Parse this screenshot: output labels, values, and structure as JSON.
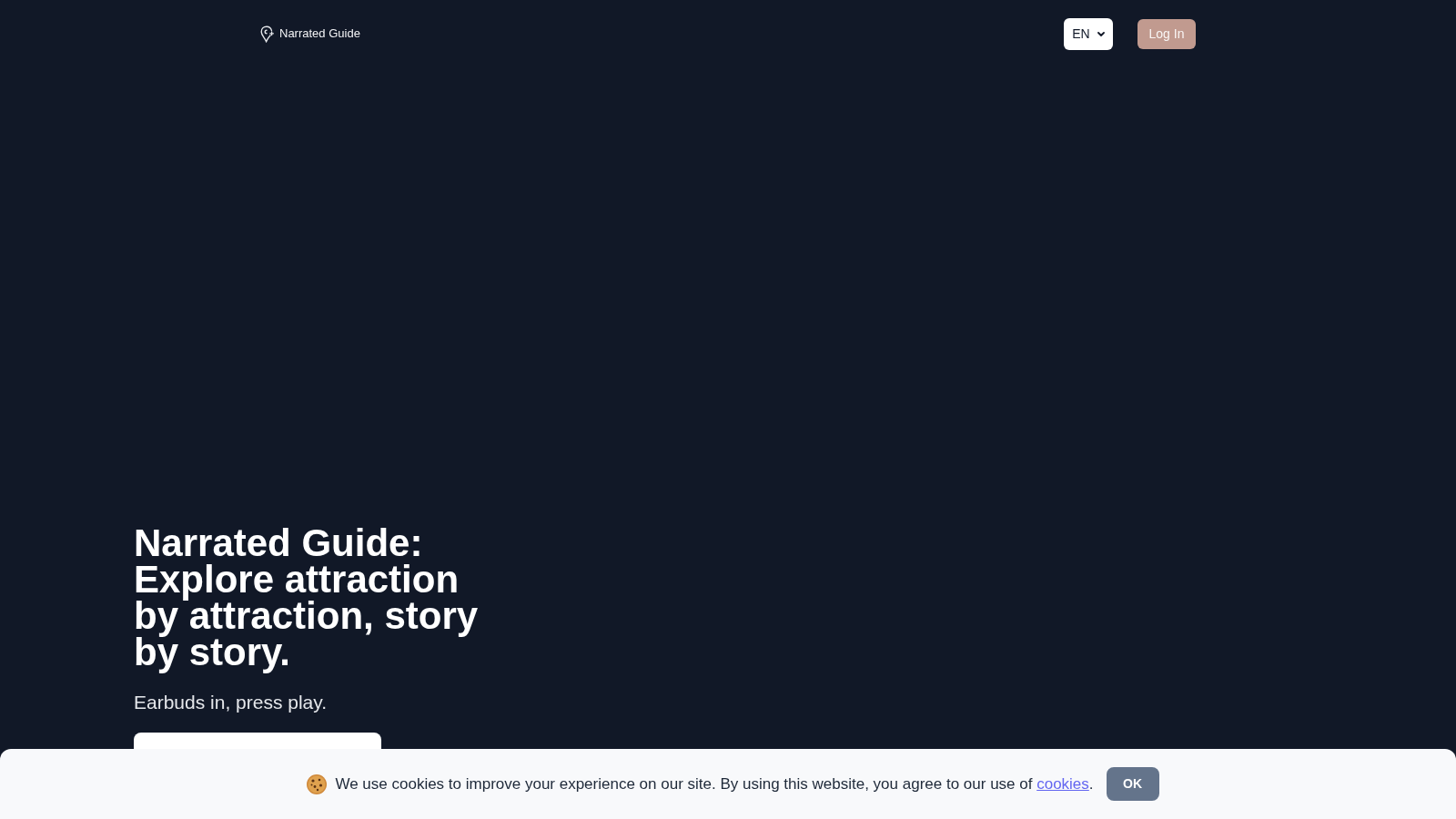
{
  "header": {
    "logo": {
      "text": "Narrated Guide"
    },
    "language_select": {
      "value": "EN"
    },
    "login_button": {
      "label": "Log In"
    }
  },
  "hero": {
    "title": "Narrated Guide: Explore attraction by attraction, story by story.",
    "subtitle": "Earbuds in, press play."
  },
  "cookie_banner": {
    "message": "We use cookies to improve your experience on our site. By using this website, you agree to our use of ",
    "link": "cookies",
    "after_link": ".",
    "button": "OK"
  }
}
